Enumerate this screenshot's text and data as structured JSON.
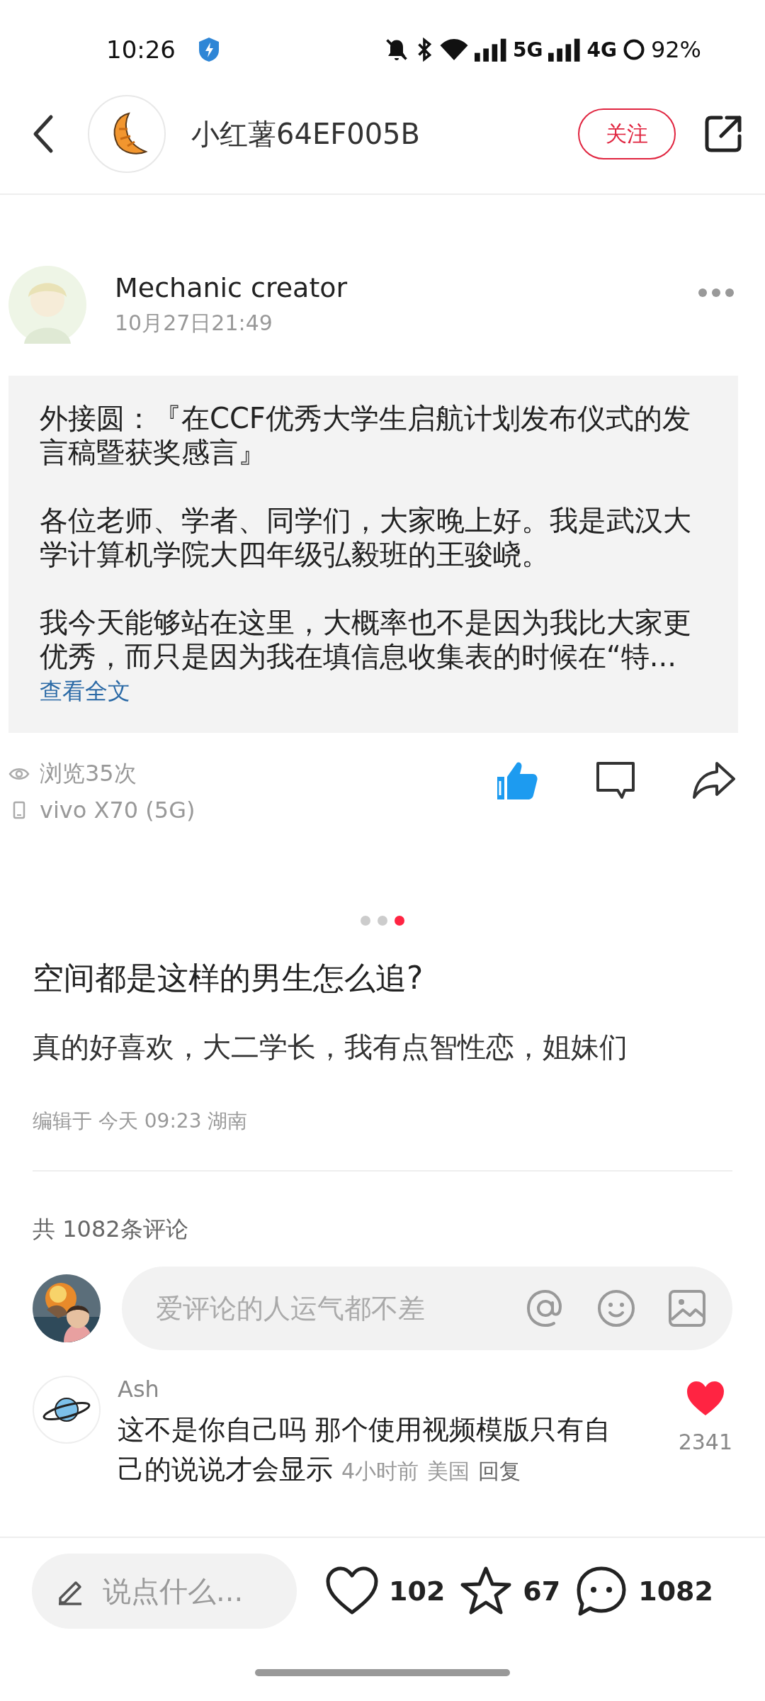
{
  "status_bar": {
    "time": "10:26",
    "network_1": "5G",
    "network_2": "4G",
    "battery": "92%"
  },
  "header": {
    "title": "小红薯64EF005B",
    "follow_button": "关注"
  },
  "shared_post": {
    "author": "Mechanic creator",
    "date": "10月27日21:49",
    "paragraphs": [
      "外接圆：『在CCF优秀大学生启航计划发布仪式的发言稿暨获奖感言』",
      "各位老师、学者、同学们，大家晚上好。我是武汉大学计算机学院大四年级弘毅班的王骏峣。",
      "我今天能够站在这里，大概率也不是因为我比大家更优秀，而只是因为我在填信息收集表的时候在“特..."
    ],
    "read_more": "查看全文",
    "views": "浏览35次",
    "device": "vivo X70 (5G)",
    "liked": true
  },
  "pager": [
    {
      "selected": false
    },
    {
      "selected": false
    },
    {
      "selected": true
    }
  ],
  "note": {
    "title": "空间都是这样的男生怎么追?",
    "body": "真的好喜欢，大二学长，我有点智性恋，姐妹们",
    "edited": "编辑于 今天 09:23 湖南"
  },
  "comments": {
    "count_label": "共 1082条评论",
    "input": {
      "placeholder": "爱评论的人运气都不差"
    },
    "items": [
      {
        "author": "Ash",
        "text": "这不是你自己吗 那个使用视频模版只有自己的说说才会显示",
        "time": "4小时前",
        "location": "美国",
        "reply": "回复",
        "likes": "2341",
        "liked": true
      }
    ]
  },
  "bottom_bar": {
    "placeholder": "说点什么...",
    "likes": "102",
    "collects": "67",
    "comments": "1082"
  }
}
